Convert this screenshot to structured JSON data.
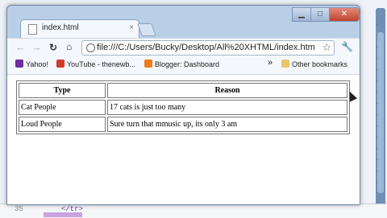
{
  "browser": {
    "tab": {
      "title": "index.html",
      "close": "×"
    },
    "window_controls": {
      "minimize": "▁",
      "maximize": "□",
      "close": "✕"
    },
    "address": "file:///C:/Users/Bucky/Desktop/All%20XHTML/index.htm"
  },
  "bookmarks": [
    {
      "label": "Yahoo!",
      "color": "#6b2fa0"
    },
    {
      "label": "YouTube - thenewb...",
      "color": "#d23b2a"
    },
    {
      "label": "Blogger: Dashboard",
      "color": "#f07a1c"
    }
  ],
  "bookmarks_chevron": "»",
  "other_bookmarks": "Other bookmarks",
  "table": {
    "headers": [
      "Type",
      "Reason"
    ],
    "rows": [
      [
        "Cat People",
        "17 cats is just too many"
      ],
      [
        "Loud People",
        "Sure turn that mmusic up, its only 3 am"
      ]
    ]
  },
  "editor": {
    "line_number": "35",
    "code": "</tr>"
  }
}
